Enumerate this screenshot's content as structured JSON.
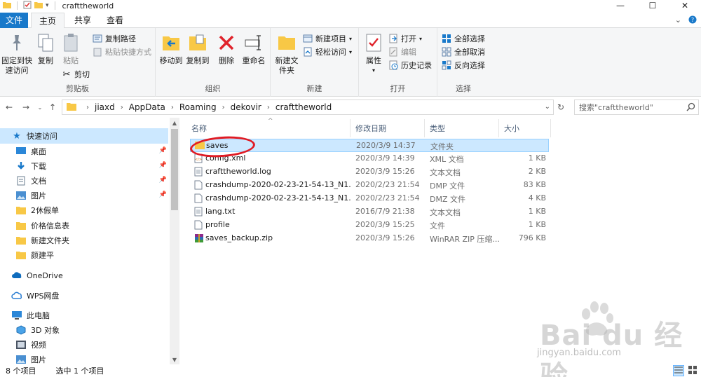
{
  "window": {
    "title": "crafttheworld",
    "controls": {
      "minimize": "—",
      "maximize": "☐",
      "close": "✕"
    }
  },
  "tabs": [
    {
      "label": "文件"
    },
    {
      "label": "主页"
    },
    {
      "label": "共享"
    },
    {
      "label": "查看"
    }
  ],
  "ribbon": {
    "clipboard": {
      "label": "剪贴板",
      "pin": "固定到快速访问",
      "copy": "复制",
      "paste": "粘贴",
      "copy_path": "复制路径",
      "paste_shortcut": "粘贴快捷方式",
      "cut": "剪切"
    },
    "organize": {
      "label": "组织",
      "move_to": "移动到",
      "copy_to": "复制到",
      "delete": "删除",
      "rename": "重命名"
    },
    "new": {
      "label": "新建",
      "new_folder": "新建文件夹",
      "new_item": "新建项目",
      "easy_access": "轻松访问"
    },
    "open": {
      "label": "打开",
      "properties": "属性",
      "open": "打开",
      "edit": "编辑",
      "history": "历史记录"
    },
    "select": {
      "label": "选择",
      "select_all": "全部选择",
      "select_none": "全部取消",
      "invert": "反向选择"
    }
  },
  "address": {
    "crumbs": [
      "jiaxd",
      "AppData",
      "Roaming",
      "dekovir",
      "crafttheworld"
    ],
    "search_placeholder": "搜索\"crafttheworld\""
  },
  "navpane": {
    "items": [
      {
        "label": "快速访问",
        "icon": "star-icon",
        "pinned": false
      },
      {
        "label": "桌面",
        "icon": "desktop-icon",
        "pinned": true
      },
      {
        "label": "下载",
        "icon": "download-icon",
        "pinned": true
      },
      {
        "label": "文档",
        "icon": "document-icon",
        "pinned": true
      },
      {
        "label": "图片",
        "icon": "picture-icon",
        "pinned": true
      },
      {
        "label": "2休假单",
        "icon": "folder-icon",
        "pinned": false
      },
      {
        "label": "价格信息表",
        "icon": "folder-icon",
        "pinned": false
      },
      {
        "label": "新建文件夹",
        "icon": "folder-icon",
        "pinned": false
      },
      {
        "label": "颜建平",
        "icon": "folder-icon",
        "pinned": false
      },
      {
        "label": "OneDrive",
        "icon": "cloud-icon",
        "pinned": false
      },
      {
        "label": "WPS网盘",
        "icon": "wps-cloud-icon",
        "pinned": false
      },
      {
        "label": "此电脑",
        "icon": "computer-icon",
        "pinned": false
      },
      {
        "label": "3D 对象",
        "icon": "cube-icon",
        "pinned": false
      },
      {
        "label": "视频",
        "icon": "video-icon",
        "pinned": false
      },
      {
        "label": "图片",
        "icon": "picture-icon",
        "pinned": false
      }
    ]
  },
  "filelist": {
    "columns": {
      "name": "名称",
      "date": "修改日期",
      "type": "类型",
      "size": "大小"
    },
    "rows": [
      {
        "name": "saves",
        "date": "2020/3/9 14:37",
        "type": "文件夹",
        "size": "",
        "icon": "folder-icon"
      },
      {
        "name": "config.xml",
        "date": "2020/3/9 14:39",
        "type": "XML 文档",
        "size": "1 KB",
        "icon": "xml-file-icon"
      },
      {
        "name": "crafttheworld.log",
        "date": "2020/3/9 15:26",
        "type": "文本文档",
        "size": "2 KB",
        "icon": "text-file-icon"
      },
      {
        "name": "crashdump-2020-02-23-21-54-13_N1...",
        "date": "2020/2/23 21:54",
        "type": "DMP 文件",
        "size": "83 KB",
        "icon": "file-icon"
      },
      {
        "name": "crashdump-2020-02-23-21-54-13_N1...",
        "date": "2020/2/23 21:54",
        "type": "DMZ 文件",
        "size": "4 KB",
        "icon": "file-icon"
      },
      {
        "name": "lang.txt",
        "date": "2016/7/9 21:38",
        "type": "文本文档",
        "size": "1 KB",
        "icon": "text-file-icon"
      },
      {
        "name": "profile",
        "date": "2020/3/9 15:25",
        "type": "文件",
        "size": "1 KB",
        "icon": "file-icon"
      },
      {
        "name": "saves_backup.zip",
        "date": "2020/3/9 15:26",
        "type": "WinRAR ZIP 压缩...",
        "size": "796 KB",
        "icon": "winrar-icon"
      }
    ]
  },
  "status": {
    "count": "8 个项目",
    "selected": "选中 1 个项目"
  },
  "watermark": {
    "text": "Bai du 经验",
    "url": "jingyan.baidu.com"
  },
  "colors": {
    "accent": "#1979ca",
    "selection": "#cce8ff",
    "folder": "#f8c846",
    "annotation": "#e01b24"
  }
}
